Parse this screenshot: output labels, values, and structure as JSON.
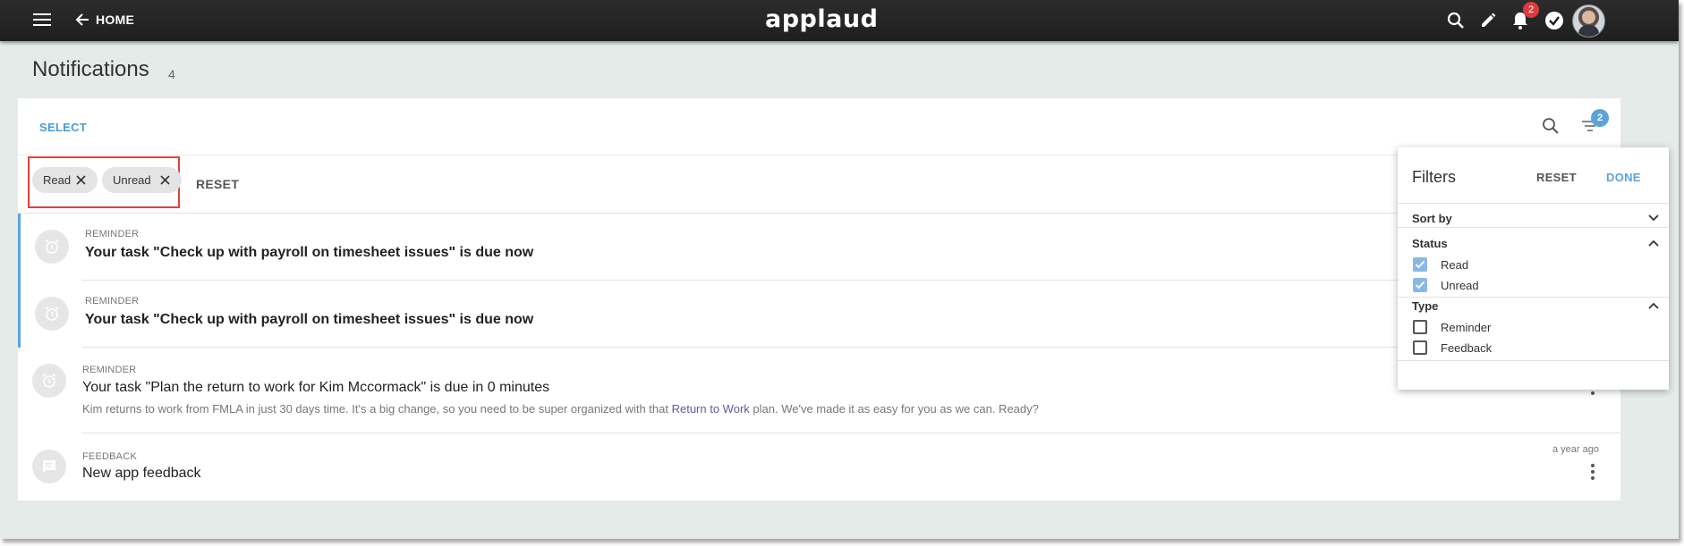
{
  "topbar": {
    "home_label": "HOME",
    "brand": "applaud",
    "notification_badge": "2",
    "menu_icon": "hamburger-menu-icon",
    "back_icon": "arrow-left-icon",
    "search_icon": "search-icon",
    "edit_icon": "pencil-icon",
    "bell_icon": "bell-icon",
    "tasks_icon": "check-circle-icon"
  },
  "page": {
    "title": "Notifications",
    "count": "4"
  },
  "toolbar": {
    "select_label": "SELECT",
    "filter_badge": "2"
  },
  "chips": [
    {
      "label": "Read"
    },
    {
      "label": "Unread"
    }
  ],
  "chips_reset": "RESET",
  "notifications": [
    {
      "type": "REMINDER",
      "title": "Your task \"Check up with payroll on timesheet issues\" is due now",
      "unread": true
    },
    {
      "type": "REMINDER",
      "title": "Your task \"Check up with payroll on timesheet issues\" is due now",
      "unread": true
    },
    {
      "type": "REMINDER",
      "title": "Your task \"Plan the return to work for Kim Mccormack\" is due in 0 minutes",
      "body_prefix": "Kim returns to work from FMLA in just 30 days time. It's a big change, so you need to be super organized with that ",
      "body_link": "Return to Work",
      "body_suffix": " plan. We've made it as easy for you as we can. Ready?",
      "unread": false
    },
    {
      "type": "FEEDBACK",
      "title": "New app feedback",
      "time": "a year ago",
      "unread": false
    }
  ],
  "filters": {
    "title": "Filters",
    "reset_label": "RESET",
    "done_label": "DONE",
    "sort_by_label": "Sort by",
    "status_label": "Status",
    "status_options": [
      {
        "label": "Read",
        "checked": true
      },
      {
        "label": "Unread",
        "checked": true
      }
    ],
    "type_label": "Type",
    "type_options": [
      {
        "label": "Reminder",
        "checked": false
      },
      {
        "label": "Feedback",
        "checked": false
      }
    ]
  },
  "colors": {
    "accent": "#5aa4dc",
    "highlight_border": "#e2403f",
    "badge_red": "#e0393e"
  }
}
